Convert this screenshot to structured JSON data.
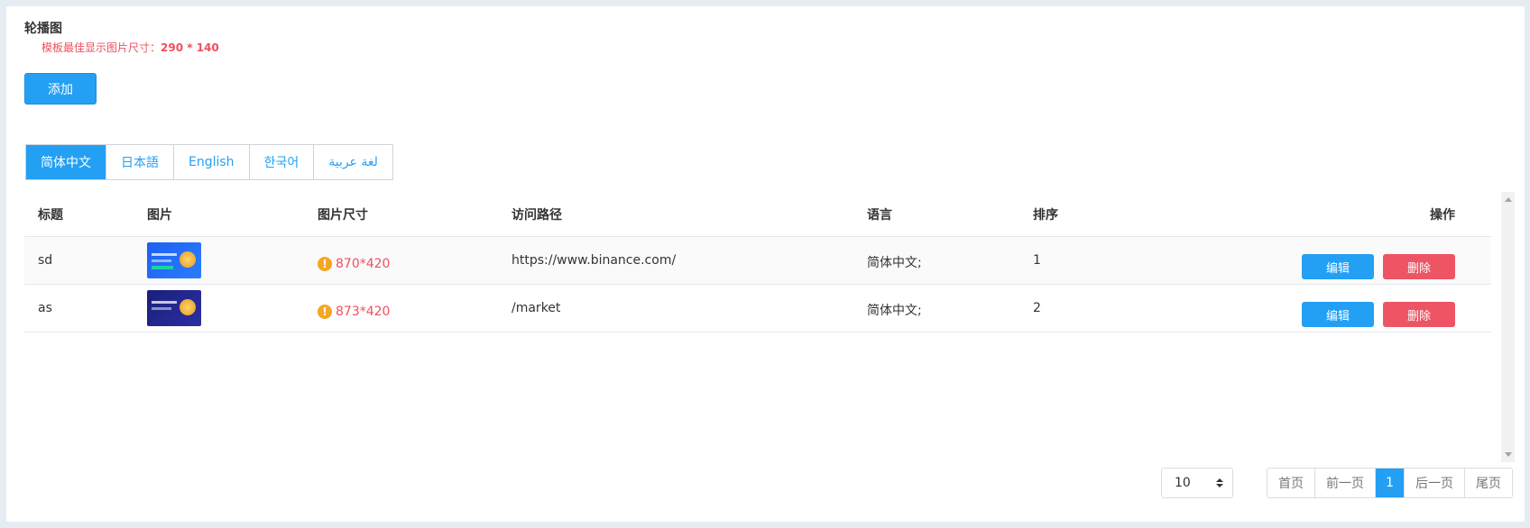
{
  "section": {
    "title": "轮播图",
    "hint_prefix": "模板最佳显示图片尺寸：",
    "hint_size": "290 * 140"
  },
  "toolbar": {
    "add_label": "添加"
  },
  "tabs": [
    {
      "label": "简体中文",
      "active": true
    },
    {
      "label": "日本語",
      "active": false
    },
    {
      "label": "English",
      "active": false
    },
    {
      "label": "한국어",
      "active": false
    },
    {
      "label": "لغة عربية",
      "active": false
    }
  ],
  "table": {
    "headers": {
      "title": "标题",
      "image": "图片",
      "image_size": "图片尺寸",
      "path": "访问路径",
      "language": "语言",
      "sort": "排序",
      "ops": "操作"
    },
    "rows": [
      {
        "title": "sd",
        "image_size": "870*420",
        "path": "https://www.binance.com/",
        "language": "简体中文;",
        "sort": "1",
        "edit": "编辑",
        "delete": "删除"
      },
      {
        "title": "as",
        "image_size": "873*420",
        "path": "/market",
        "language": "简体中文;",
        "sort": "2",
        "edit": "编辑",
        "delete": "删除"
      }
    ]
  },
  "pagination": {
    "page_size": "10",
    "first": "首页",
    "prev": "前一页",
    "current": "1",
    "next": "后一页",
    "last": "尾页"
  },
  "colors": {
    "primary": "#23a0f4",
    "danger": "#ed5565",
    "warning": "#f5a623",
    "hint": "#ef4f5f"
  }
}
